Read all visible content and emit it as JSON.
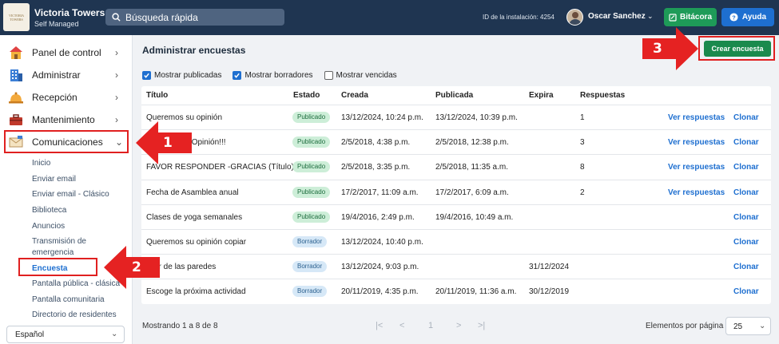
{
  "topbar": {
    "logo_text": "VICTORIA TOWERS",
    "title": "Victoria Towers",
    "subtitle": "Self Managed",
    "search_placeholder": "Búsqueda rápida",
    "install_id": "ID de la instalación: 4254",
    "user_name": "Oscar Sanchez",
    "bitacora_label": "Bitácora",
    "ayuda_label": "Ayuda",
    "colors": {
      "bar": "#1f3551",
      "bitacora": "#1e9b58",
      "ayuda": "#1e6fd0"
    }
  },
  "sidebar": {
    "items": [
      {
        "label": "Panel de control",
        "icon": "house-icon"
      },
      {
        "label": "Administrar",
        "icon": "building-icon"
      },
      {
        "label": "Recepción",
        "icon": "bell-icon"
      },
      {
        "label": "Mantenimiento",
        "icon": "toolbox-icon"
      },
      {
        "label": "Comunicaciones",
        "icon": "envelope-icon",
        "expanded": true
      }
    ],
    "sub_items": [
      {
        "label": "Inicio"
      },
      {
        "label": "Enviar email"
      },
      {
        "label": "Enviar email - Clásico"
      },
      {
        "label": "Biblioteca"
      },
      {
        "label": "Anuncios"
      },
      {
        "label": "Transmisión de"
      },
      {
        "label": "emergencia"
      },
      {
        "label": "Encuesta",
        "active": true
      },
      {
        "label": "Pantalla pública - clásica"
      },
      {
        "label": "Pantalla comunitaria"
      },
      {
        "label": "Directorio de residentes"
      }
    ],
    "language": "Español"
  },
  "main": {
    "title": "Administrar encuestas",
    "create_button": "Crear encuesta",
    "filters": [
      {
        "label": "Mostrar publicadas",
        "checked": true
      },
      {
        "label": "Mostrar borradores",
        "checked": true
      },
      {
        "label": "Mostrar vencidas",
        "checked": false
      }
    ],
    "columns": [
      "Título",
      "Estado",
      "Creada",
      "Publicada",
      "Expira",
      "Respuestas"
    ],
    "rows": [
      {
        "title": "Queremos su opinión",
        "status": "Publicado",
        "created": "13/12/2024, 10:24 p.m.",
        "published": "13/12/2024, 10:39 p.m.",
        "expires": "",
        "responses": "1",
        "view": "Ver respuestas",
        "clone": "Clonar"
      },
      {
        "title": "…onocer su Opinión!!!",
        "status": "Publicado",
        "created": "2/5/2018, 4:38 p.m.",
        "published": "2/5/2018, 12:38 p.m.",
        "expires": "",
        "responses": "3",
        "view": "Ver respuestas",
        "clone": "Clonar"
      },
      {
        "title": "FAVOR RESPONDER -GRACIAS (Título)",
        "status": "Publicado",
        "created": "2/5/2018, 3:35 p.m.",
        "published": "2/5/2018, 11:35 a.m.",
        "expires": "",
        "responses": "8",
        "view": "Ver respuestas",
        "clone": "Clonar"
      },
      {
        "title": "Fecha de Asamblea anual",
        "status": "Publicado",
        "created": "17/2/2017, 11:09 a.m.",
        "published": "17/2/2017, 6:09 a.m.",
        "expires": "",
        "responses": "2",
        "view": "Ver respuestas",
        "clone": "Clonar"
      },
      {
        "title": "Clases de yoga semanales",
        "status": "Publicado",
        "created": "19/4/2016, 2:49 p.m.",
        "published": "19/4/2016, 10:49 a.m.",
        "expires": "",
        "responses": "",
        "view": "",
        "clone": "Clonar"
      },
      {
        "title": "Queremos su opinión copiar",
        "status": "Borrador",
        "created": "13/12/2024, 10:40 p.m.",
        "published": "",
        "expires": "",
        "responses": "",
        "view": "",
        "clone": "Clonar"
      },
      {
        "title": "…or de las paredes",
        "status": "Borrador",
        "created": "13/12/2024, 9:03 p.m.",
        "published": "",
        "expires": "31/12/2024",
        "responses": "",
        "view": "",
        "clone": "Clonar"
      },
      {
        "title": "Escoge la próxima actividad",
        "status": "Borrador",
        "created": "20/11/2019, 4:35 p.m.",
        "published": "20/11/2019, 11:36 a.m.",
        "expires": "30/12/2019",
        "responses": "",
        "view": "",
        "clone": "Clonar"
      }
    ],
    "footer": {
      "showing": "Mostrando 1 a 8 de 8",
      "pager": [
        "|<",
        "<",
        "1",
        ">",
        ">|"
      ],
      "per_page_label": "Elementos por página",
      "per_page_value": "25"
    }
  },
  "annotations": [
    "1",
    "2",
    "3"
  ]
}
